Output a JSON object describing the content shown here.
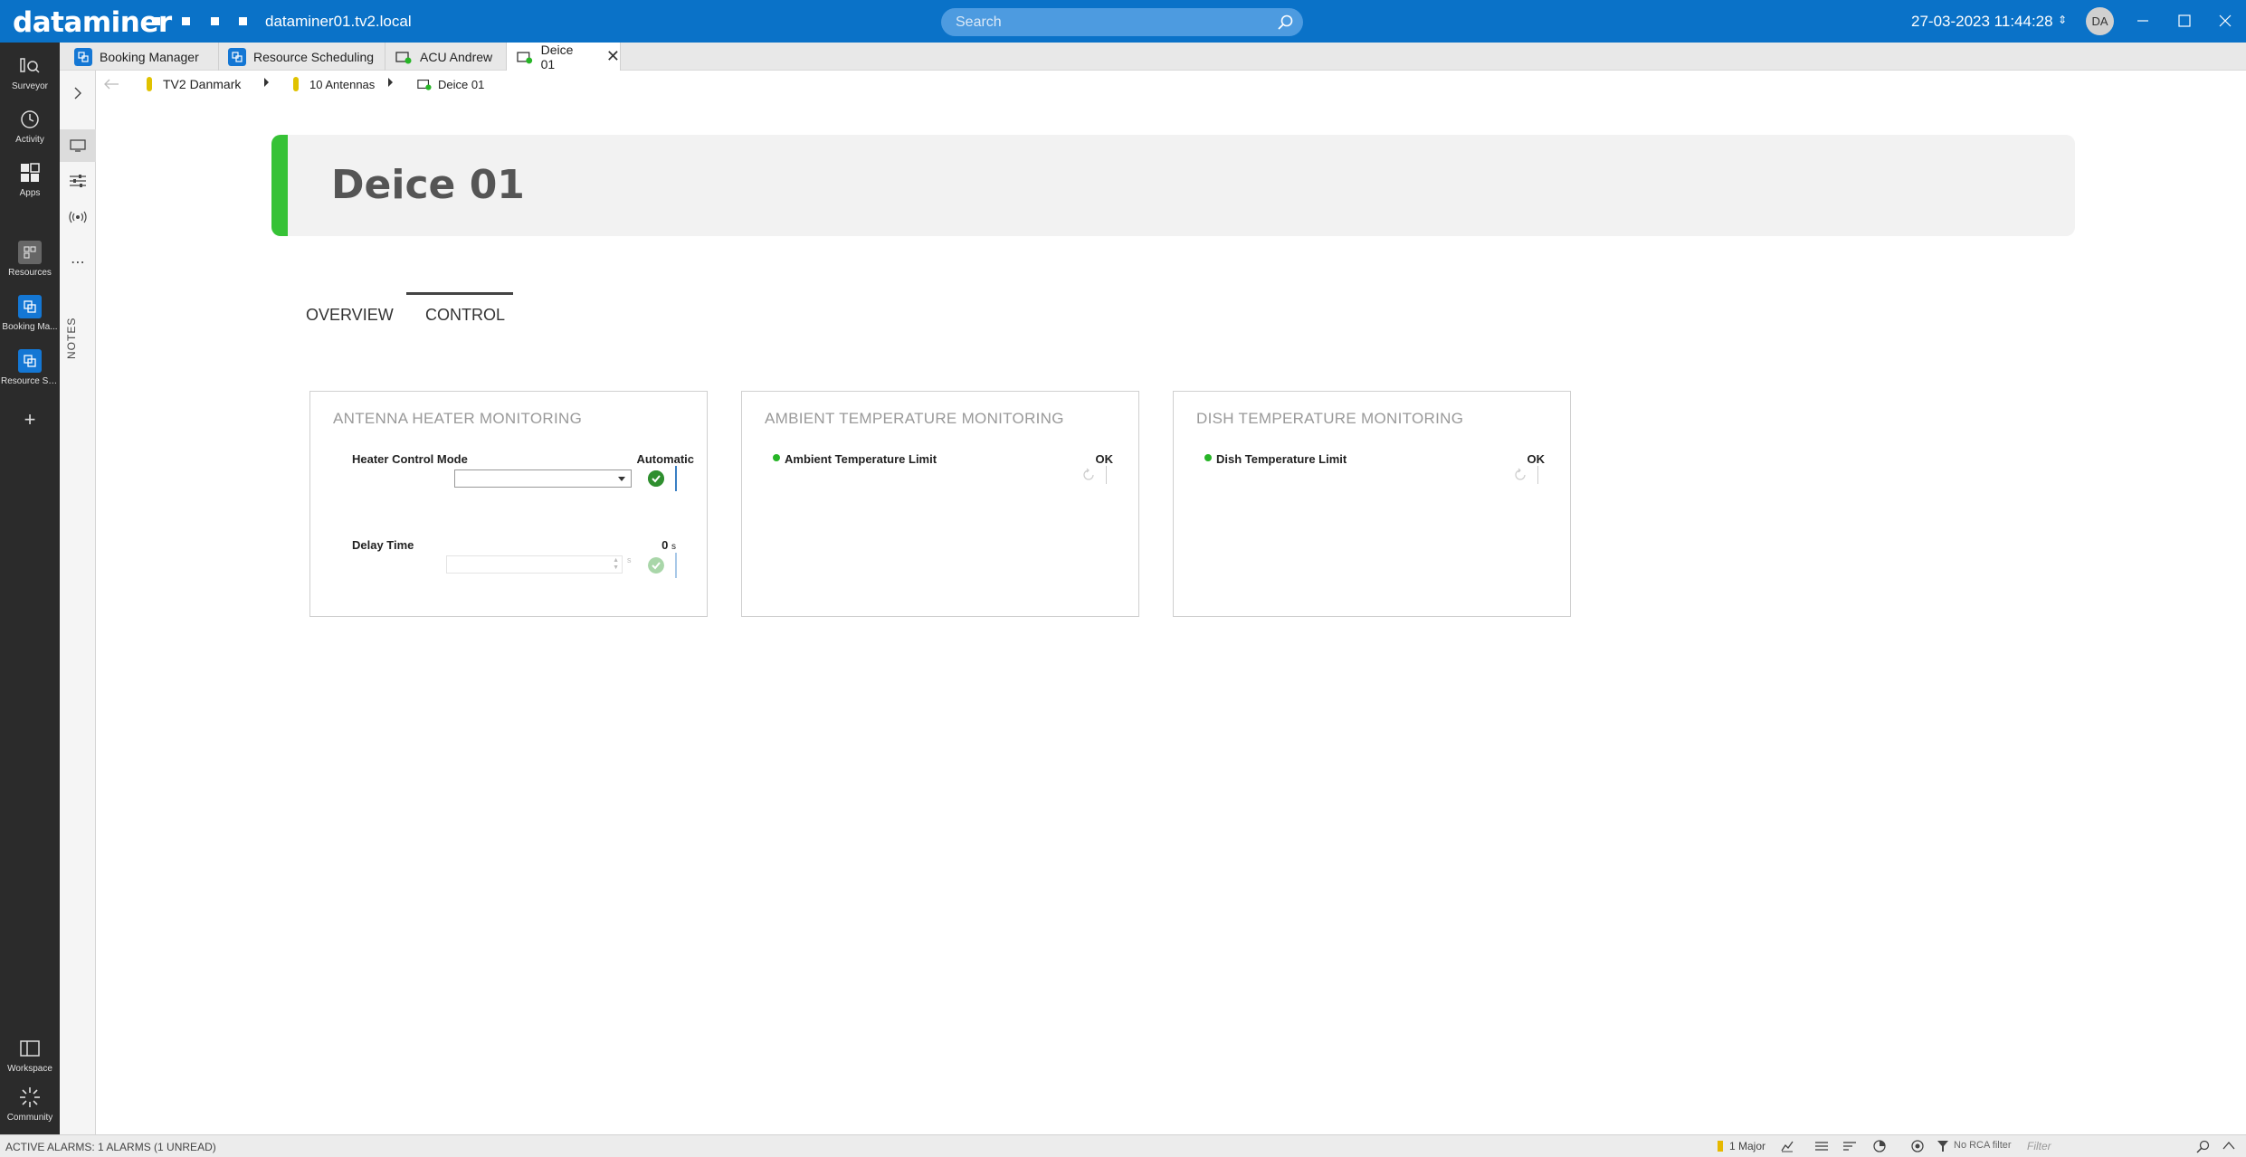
{
  "titlebar": {
    "logo": "dataminer",
    "hostname": "dataminer01.tv2.local",
    "search_placeholder": "Search",
    "datetime": "27-03-2023 11:44:28",
    "avatar_initials": "DA",
    "brand_color": "#0a72c8"
  },
  "app_sidebar": {
    "items": [
      {
        "label": "Surveyor",
        "icon": "surveyor-icon"
      },
      {
        "label": "Activity",
        "icon": "activity-icon"
      },
      {
        "label": "Apps",
        "icon": "apps-icon"
      },
      {
        "label": "Resources",
        "icon": "resources-icon"
      },
      {
        "label": "Booking Ma...",
        "icon": "booking-manager-icon"
      },
      {
        "label": "Resource Sc...",
        "icon": "resource-scheduling-icon"
      },
      {
        "label": "Workspace",
        "icon": "workspace-icon"
      },
      {
        "label": "Community",
        "icon": "community-icon"
      }
    ]
  },
  "sec_sidebar": {
    "notes_label": "NOTES"
  },
  "tabs": [
    {
      "label": "Booking Manager",
      "icon": "booking-manager-icon"
    },
    {
      "label": "Resource Scheduling",
      "icon": "resource-scheduling-icon"
    },
    {
      "label": "ACU Andrew",
      "icon": "element-icon"
    },
    {
      "label": "Deice 01",
      "icon": "element-icon",
      "active": true
    }
  ],
  "breadcrumb": [
    {
      "label": "TV2 Danmark"
    },
    {
      "label": "10 Antennas"
    },
    {
      "label": "Deice 01"
    }
  ],
  "element": {
    "title": "Deice 01",
    "status_color": "#36c236"
  },
  "page_tabs": [
    {
      "label": "OVERVIEW"
    },
    {
      "label": "CONTROL",
      "active": true
    }
  ],
  "cards": {
    "antenna": {
      "title": "ANTENNA HEATER MONITORING",
      "heater_label": "Heater Control Mode",
      "heater_value": "Automatic",
      "delay_label": "Delay Time",
      "delay_value": "0",
      "delay_unit": "s",
      "delay_input_unit": "s"
    },
    "ambient": {
      "title": "AMBIENT TEMPERATURE MONITORING",
      "param_label": "Ambient Temperature Limit",
      "param_value": "OK"
    },
    "dish": {
      "title": "DISH TEMPERATURE MONITORING",
      "param_label": "Dish Temperature Limit",
      "param_value": "OK"
    }
  },
  "statusbar": {
    "alarms": "ACTIVE ALARMS: 1 ALARMS (1 UNREAD)",
    "major": "1 Major",
    "rca": "No RCA filter",
    "filter_placeholder": "Filter"
  }
}
